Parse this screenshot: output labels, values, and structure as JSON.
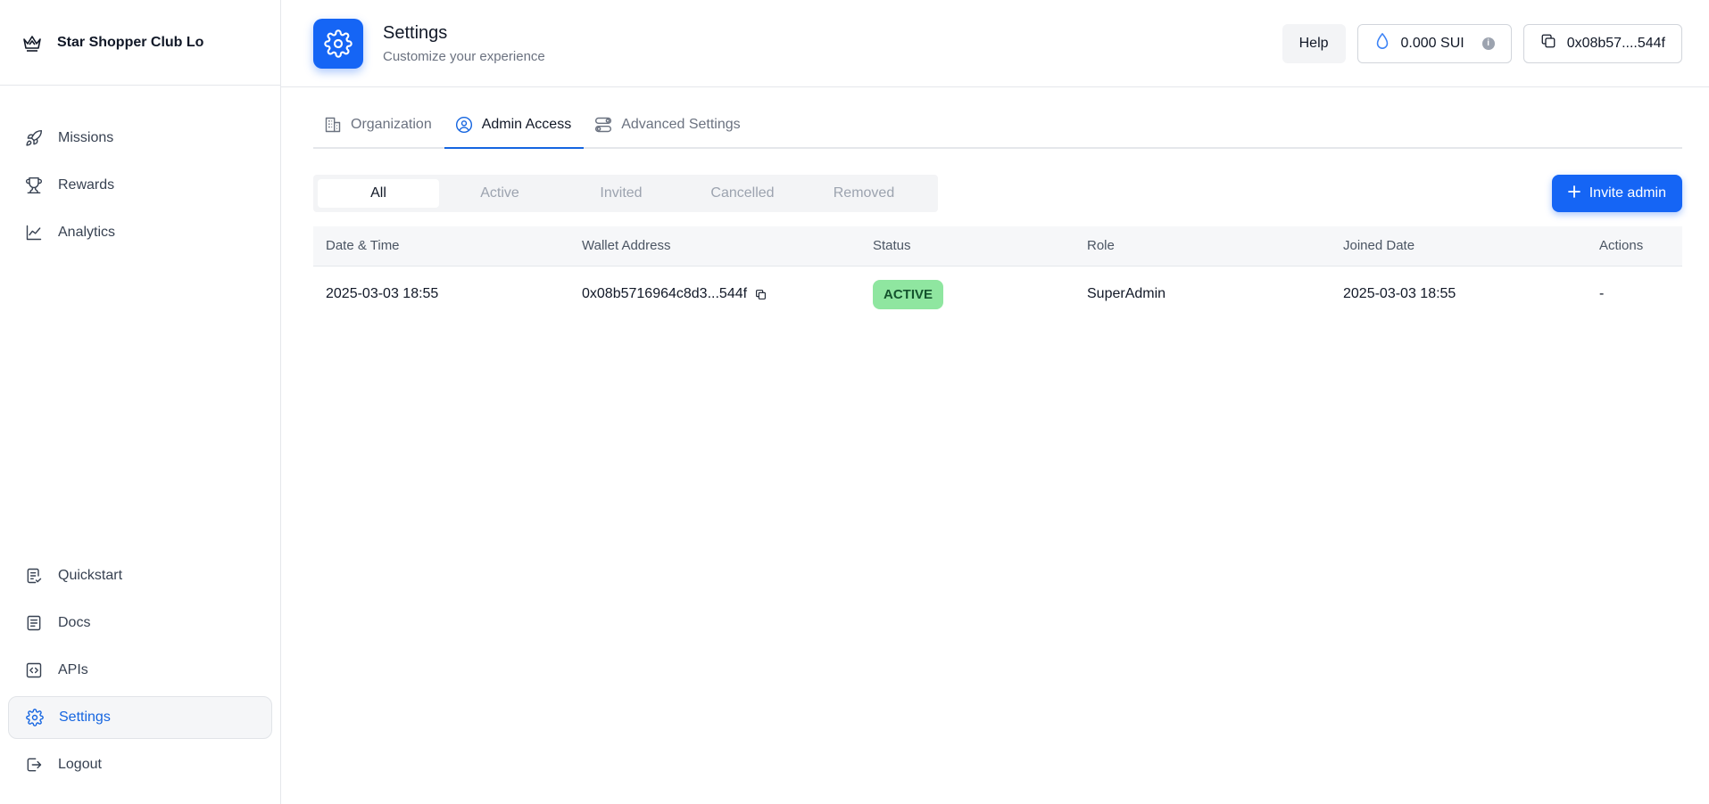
{
  "brand": {
    "name": "Star Shopper Club Lo",
    "icon": "crown-icon"
  },
  "sidebar": {
    "top_items": [
      {
        "label": "Missions",
        "icon": "rocket-icon"
      },
      {
        "label": "Rewards",
        "icon": "trophy-icon"
      },
      {
        "label": "Analytics",
        "icon": "chart-line-icon"
      }
    ],
    "bottom_items": [
      {
        "label": "Quickstart",
        "icon": "checklist-icon"
      },
      {
        "label": "Docs",
        "icon": "document-icon"
      },
      {
        "label": "APIs",
        "icon": "code-icon"
      },
      {
        "label": "Settings",
        "icon": "gear-icon",
        "active": true
      },
      {
        "label": "Logout",
        "icon": "logout-icon"
      }
    ]
  },
  "header": {
    "title": "Settings",
    "subtitle": "Customize your experience",
    "help_label": "Help",
    "balance": "0.000 SUI",
    "wallet": "0x08b57....544f"
  },
  "tabs": [
    {
      "label": "Organization",
      "icon": "building-icon"
    },
    {
      "label": "Admin Access",
      "icon": "user-circle-icon",
      "active": true
    },
    {
      "label": "Advanced Settings",
      "icon": "toggles-icon"
    }
  ],
  "filters": {
    "options": [
      "All",
      "Active",
      "Invited",
      "Cancelled",
      "Removed"
    ],
    "selected": "All"
  },
  "invite_button": {
    "label": "Invite admin"
  },
  "table": {
    "columns": [
      "Date & Time",
      "Wallet Address",
      "Status",
      "Role",
      "Joined Date",
      "Actions"
    ],
    "rows": [
      {
        "date_time": "2025-03-03 18:55",
        "wallet": "0x08b5716964c8d3...544f",
        "status": "ACTIVE",
        "role": "SuperAdmin",
        "joined": "2025-03-03 18:55",
        "actions": "-"
      }
    ]
  },
  "colors": {
    "primary": "#1565f5",
    "active_text": "#1565e0",
    "status_active_bg": "#8fe6a0"
  }
}
